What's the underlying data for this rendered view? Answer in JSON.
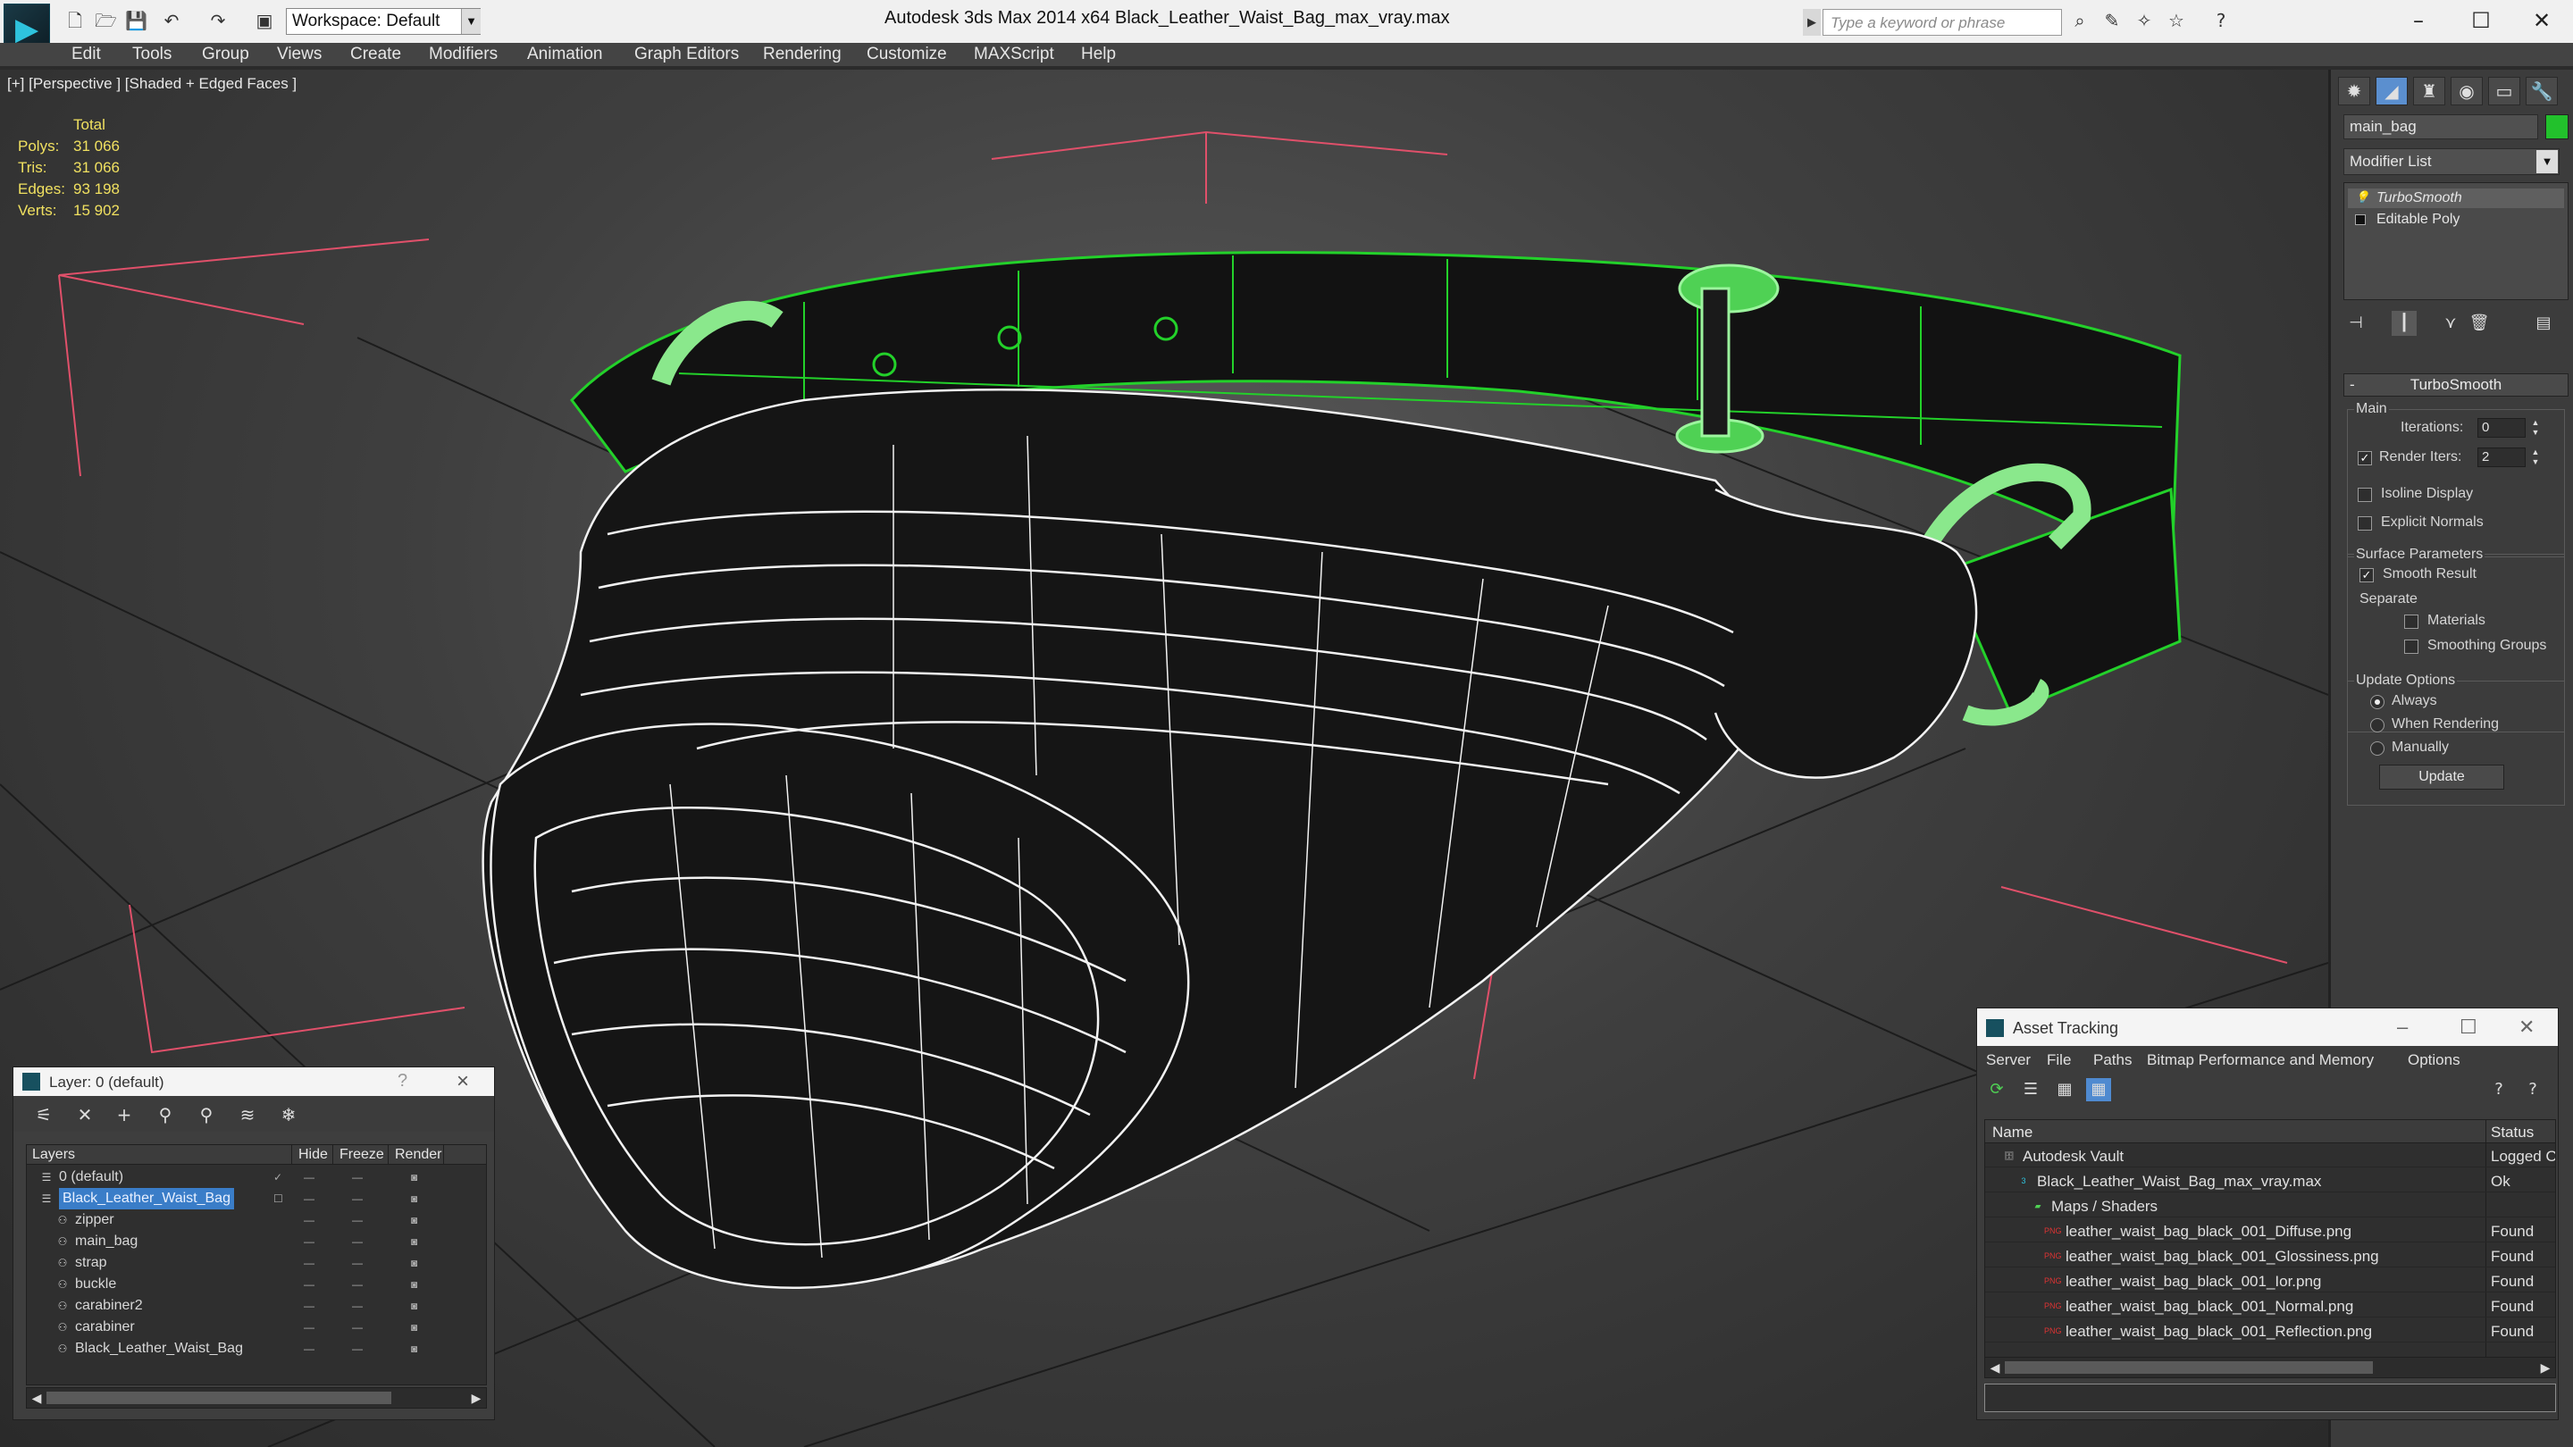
{
  "titlebar": {
    "workspace": "Workspace: Default",
    "app_title": "Autodesk 3ds Max 2014 x64",
    "file_title": "Black_Leather_Waist_Bag_max_vray.max",
    "search_placeholder": "Type a keyword or phrase"
  },
  "menu": [
    "Edit",
    "Tools",
    "Group",
    "Views",
    "Create",
    "Modifiers",
    "Animation",
    "Graph Editors",
    "Rendering",
    "Customize",
    "MAXScript",
    "Help"
  ],
  "viewport": {
    "label": "[+] [Perspective ] [Shaded + Edged Faces ]",
    "stats": {
      "header": "Total",
      "rows": [
        {
          "k": "Polys:",
          "v": "31 066"
        },
        {
          "k": "Tris:",
          "v": "31 066"
        },
        {
          "k": "Edges:",
          "v": "93 198"
        },
        {
          "k": "Verts:",
          "v": "15 902"
        }
      ]
    },
    "colors": {
      "wire_white": "#ffffff",
      "wire_green": "#23d12a",
      "grid_red": "#e0506a"
    }
  },
  "command_panel": {
    "object_name": "main_bag",
    "object_color": "#22c12c",
    "modifier_list": "Modifier List",
    "stack": [
      "TurboSmooth",
      "Editable Poly"
    ],
    "rollout_title": "TurboSmooth",
    "main_group": "Main",
    "iterations_label": "Iterations:",
    "iterations_value": "0",
    "render_iters_label": "Render Iters:",
    "render_iters_value": "2",
    "isoline_label": "Isoline Display",
    "explicit_normals_label": "Explicit Normals",
    "surface_group": "Surface Parameters",
    "smooth_result_label": "Smooth Result",
    "separate_label": "Separate",
    "materials_label": "Materials",
    "smoothing_groups_label": "Smoothing Groups",
    "update_group": "Update Options",
    "always_label": "Always",
    "when_rendering_label": "When Rendering",
    "manually_label": "Manually",
    "update_button": "Update"
  },
  "layer_window": {
    "title": "Layer: 0 (default)",
    "help": "?",
    "columns": [
      "Layers",
      "Hide",
      "Freeze",
      "Render"
    ],
    "rows": [
      {
        "name": "0 (default)",
        "indent": 0
      },
      {
        "name": "Black_Leather_Waist_Bag",
        "indent": 0,
        "selected": true
      },
      {
        "name": "zipper",
        "indent": 1
      },
      {
        "name": "main_bag",
        "indent": 1
      },
      {
        "name": "strap",
        "indent": 1
      },
      {
        "name": "buckle",
        "indent": 1
      },
      {
        "name": "carabiner2",
        "indent": 1
      },
      {
        "name": "carabiner",
        "indent": 1
      },
      {
        "name": "Black_Leather_Waist_Bag",
        "indent": 1
      }
    ]
  },
  "asset_window": {
    "title": "Asset Tracking",
    "menu": [
      "Server",
      "File",
      "Paths",
      "Bitmap Performance and Memory",
      "Options"
    ],
    "columns": [
      "Name",
      "Status"
    ],
    "rows": [
      {
        "name": "Autodesk Vault",
        "status": "Logged O",
        "indent": 0,
        "icon": "vault"
      },
      {
        "name": "Black_Leather_Waist_Bag_max_vray.max",
        "status": "Ok",
        "indent": 1,
        "icon": "max"
      },
      {
        "name": "Maps / Shaders",
        "status": "",
        "indent": 2,
        "icon": "maps"
      },
      {
        "name": "leather_waist_bag_black_001_Diffuse.png",
        "status": "Found",
        "indent": 3,
        "icon": "png"
      },
      {
        "name": "leather_waist_bag_black_001_Glossiness.png",
        "status": "Found",
        "indent": 3,
        "icon": "png"
      },
      {
        "name": "leather_waist_bag_black_001_Ior.png",
        "status": "Found",
        "indent": 3,
        "icon": "png"
      },
      {
        "name": "leather_waist_bag_black_001_Normal.png",
        "status": "Found",
        "indent": 3,
        "icon": "png"
      },
      {
        "name": "leather_waist_bag_black_001_Reflection.png",
        "status": "Found",
        "indent": 3,
        "icon": "png"
      }
    ]
  }
}
